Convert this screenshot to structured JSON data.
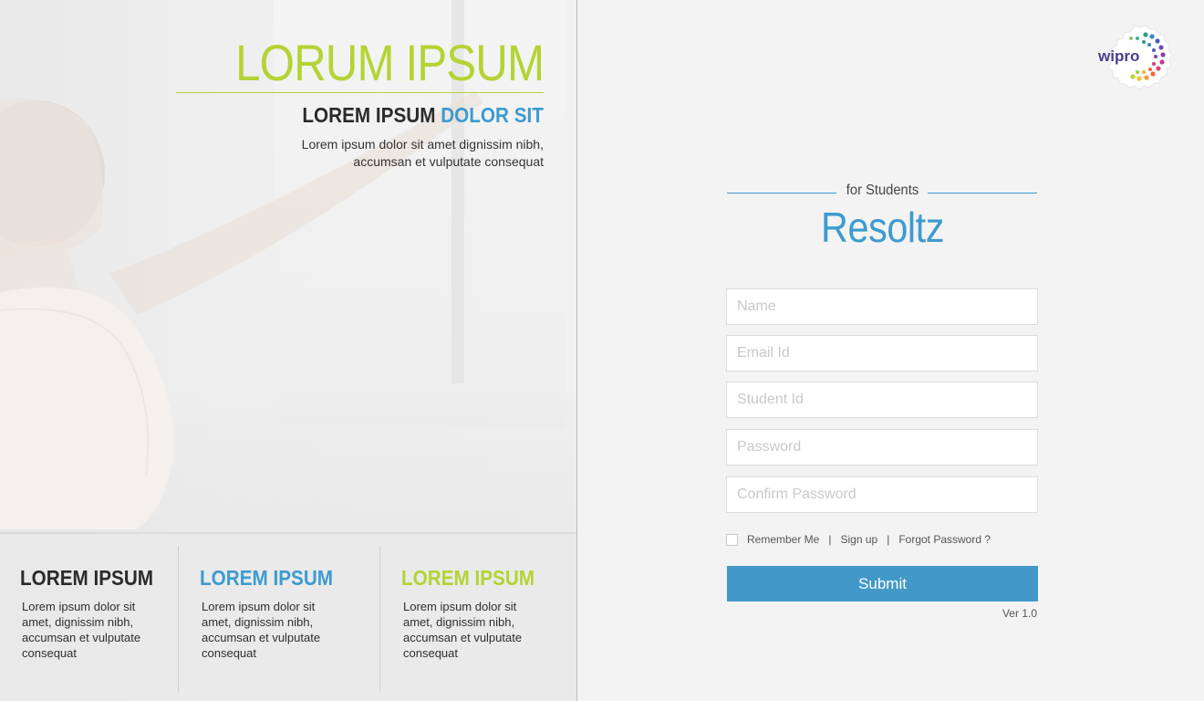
{
  "hero": {
    "title": "LORUM IPSUM",
    "subtitle_main": "LOREM IPSUM",
    "subtitle_accent": "DOLOR SIT",
    "description": "Lorem ipsum dolor sit amet dignissim nibh, accumsan et vulputate consequat"
  },
  "features": [
    {
      "heading": "LOREM IPSUM",
      "text": "Lorem ipsum dolor sit amet, dignissim nibh, accumsan et vulputate consequat"
    },
    {
      "heading": "LOREM IPSUM",
      "text": "Lorem ipsum dolor sit amet, dignissim nibh, accumsan et vulputate consequat"
    },
    {
      "heading": "LOREM IPSUM",
      "text": "Lorem ipsum dolor sit amet, dignissim nibh, accumsan et vulputate consequat"
    }
  ],
  "logo": {
    "text": "wipro"
  },
  "brand": {
    "tagline": "for Students",
    "name": "Resoltz"
  },
  "form": {
    "name_placeholder": "Name",
    "email_placeholder": "Email Id",
    "student_id_placeholder": "Student Id",
    "password_placeholder": "Password",
    "confirm_password_placeholder": "Confirm Password",
    "remember_me": "Remember Me",
    "separator": "|",
    "sign_up": "Sign up",
    "forgot_password": "Forgot Password ?",
    "submit": "Submit",
    "version": "Ver 1.0"
  },
  "colors": {
    "green_accent": "#b5d334",
    "blue_accent": "#3d9bcf",
    "button_blue": "#4299c9"
  }
}
